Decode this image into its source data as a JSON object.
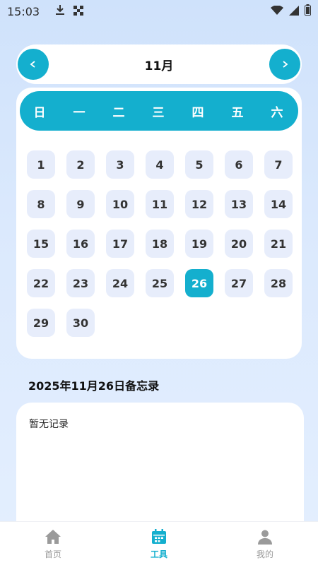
{
  "status_bar": {
    "time": "15:03",
    "icons": [
      "download-icon",
      "qr-scan-icon",
      "wifi-icon",
      "signal-icon",
      "battery-icon"
    ]
  },
  "calendar": {
    "month_label": "11月",
    "weekdays": [
      "日",
      "一",
      "二",
      "三",
      "四",
      "五",
      "六"
    ],
    "days": [
      "1",
      "2",
      "3",
      "4",
      "5",
      "6",
      "7",
      "8",
      "9",
      "10",
      "11",
      "12",
      "13",
      "14",
      "15",
      "16",
      "17",
      "18",
      "19",
      "20",
      "21",
      "22",
      "23",
      "24",
      "25",
      "26",
      "27",
      "28",
      "29",
      "30"
    ],
    "selected_day": "26",
    "accent_color": "#14afce"
  },
  "memo": {
    "title": "2025年11月26日备忘录",
    "empty_text": "暂无记录"
  },
  "bottom_nav": {
    "items": [
      {
        "label": "首页",
        "icon": "home-icon",
        "active": false
      },
      {
        "label": "工具",
        "icon": "calendar-icon",
        "active": true
      },
      {
        "label": "我的",
        "icon": "user-icon",
        "active": false
      }
    ]
  }
}
